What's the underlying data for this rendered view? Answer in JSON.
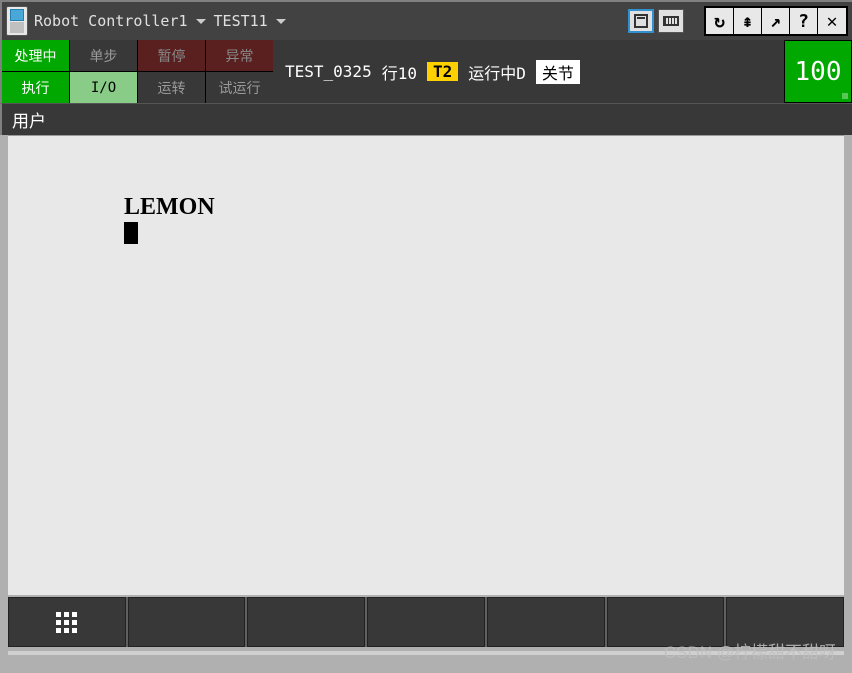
{
  "title_bar": {
    "controller": "Robot Controller1",
    "program": "TEST11"
  },
  "status": {
    "processing": "处理中",
    "step": "单步",
    "pause": "暂停",
    "abnormal": "异常",
    "execute": "执行",
    "io": "I/O",
    "run": "运转",
    "testrun": "试运行"
  },
  "info": {
    "prog_name": "TEST_0325",
    "line_label": "行10",
    "mode": "T2",
    "running": "运行中D",
    "coord": "关节"
  },
  "speed": "100",
  "panel_title": "用户",
  "display": {
    "text": "LEMON"
  },
  "sys_buttons": {
    "refresh": "↻",
    "collapse": "⇞",
    "export": "↗",
    "help": "?",
    "close": "✕"
  },
  "watermark": "CSDN @柠檬甜不甜呀"
}
